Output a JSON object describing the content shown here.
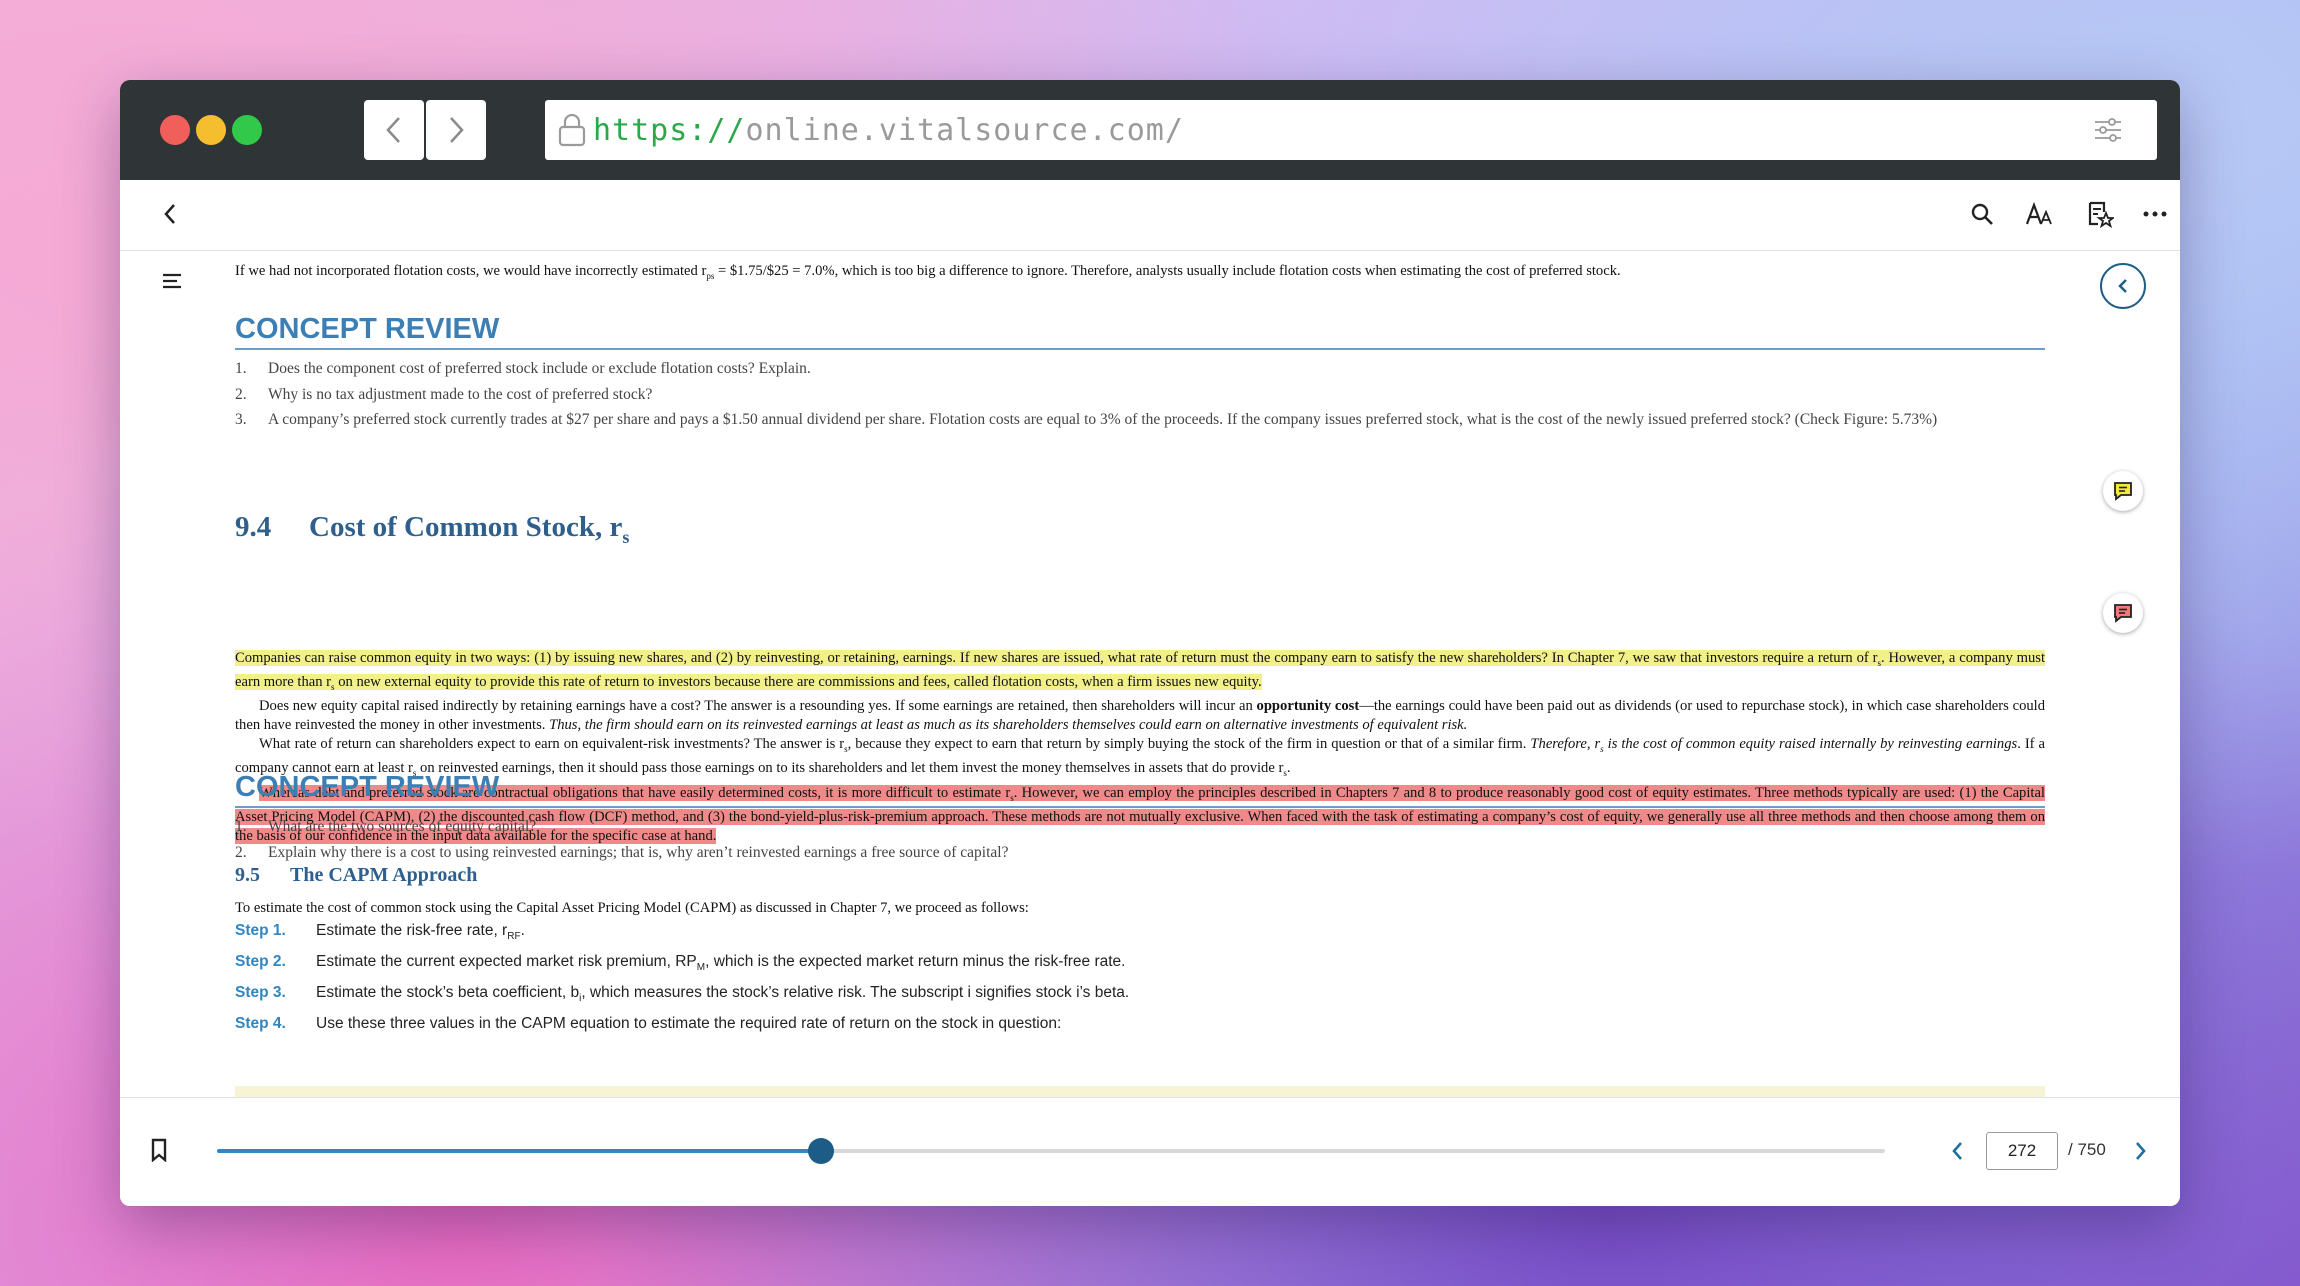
{
  "browser": {
    "url_scheme": "https://",
    "url_host": "online.vitalsource.com/",
    "colors": {
      "close": "#f15f5a",
      "minimize": "#f5be2e",
      "maximize": "#32c84a",
      "scheme": "#2ba84a",
      "host": "#9a9a9a"
    }
  },
  "reader": {
    "top_paragraph_pre": "If we had not incorporated flotation costs, we would have incorrectly estimated r",
    "top_paragraph_sub": "ps",
    "top_paragraph_post": " = $1.75/$25 = 7.0%, which is too big a difference to ignore. Therefore, analysts usually include flotation costs when estimating the cost of preferred stock.",
    "concept_review_1": {
      "title": "CONCEPT REVIEW",
      "items": [
        {
          "num": "1.",
          "text": "Does the component cost of preferred stock include or exclude flotation costs? Explain."
        },
        {
          "num": "2.",
          "text": "Why is no tax adjustment made to the cost of preferred stock?"
        },
        {
          "num": "3.",
          "text": "A company’s preferred stock currently trades at $27 per share and pays a $1.50 annual dividend per share. Flotation costs are equal to 3% of the proceeds. If the company issues preferred stock, what is the cost of the newly issued preferred stock? (Check Figure: 5.73%)"
        }
      ]
    },
    "section_94": {
      "number": "9.4",
      "title": "Cost of Common Stock, r",
      "title_sub": "s",
      "para1_a": "Companies can raise common equity in two ways: (1) by issuing new shares, and (2) by reinvesting, or retaining, earnings. If new shares are issued, what rate of return must the company earn to satisfy the new shareholders? In Chapter 7, we saw that investors require a return of r",
      "para1_sub1": "s",
      "para1_b": ". However, a company must earn more than r",
      "para1_sub2": "s",
      "para1_c": " on new external equity to provide this rate of return to investors because there are commissions and fees, called flotation costs, when a firm issues new equity.",
      "para2_a": "Does new equity capital raised indirectly by retaining earnings have a cost? The answer is a resounding yes. If some earnings are retained, then shareholders will incur an ",
      "para2_bold": "opportunity cost",
      "para2_b": "—the earnings could have been paid out as dividends (or used to repurchase stock), in which case shareholders could then have reinvested the money in other investments. ",
      "para2_italic": "Thus, the firm should earn on its reinvested earnings at least as much as its shareholders themselves could earn on alternative investments of equivalent risk.",
      "para3_a": "What rate of return can shareholders expect to earn on equivalent-risk investments? The answer is r",
      "para3_sub1": "s",
      "para3_b": ", because they expect to earn that return by simply buying the stock of the firm in question or that of a similar firm. ",
      "para3_italic_a": "Therefore, r",
      "para3_sub2": "s",
      "para3_italic_b": " is the cost of common equity raised internally by reinvesting earnings",
      "para3_c": ". If a company cannot earn at least r",
      "para3_sub3": "s",
      "para3_d": " on reinvested earnings, then it should pass those earnings on to its shareholders and let them invest the money themselves in assets that do provide r",
      "para3_sub4": "s",
      "para3_e": ".",
      "para4_a": "Whereas debt and preferred stock are contractual obligations that have easily determined costs, it is more difficult to estimate r",
      "para4_sub": "s",
      "para4_b": ". However, we can employ the principles described in Chapters 7 and 8 to produce reasonably good cost of equity estimates. Three methods typically are used: (1) the Capital Asset Pricing Model (CAPM), (2) the discounted cash flow (DCF) method, and (3) the bond-yield-plus-risk-premium approach. These methods are not mutually exclusive. When faced with the task of estimating a company’s cost of equity, we generally use all three methods and then choose among them on the basis of our confidence in the input data available for the specific case at hand."
    },
    "concept_review_2": {
      "title": "CONCEPT REVIEW",
      "items": [
        {
          "num": "1.",
          "text": "What are the two sources of equity capital?"
        },
        {
          "num": "2.",
          "text": "Explain why there is a cost to using reinvested earnings; that is, why aren’t reinvested earnings a free source of capital?"
        }
      ]
    },
    "section_95": {
      "number": "9.5",
      "title": "The CAPM Approach",
      "intro": "To estimate the cost of common stock using the Capital Asset Pricing Model (CAPM) as discussed in Chapter 7, we proceed as follows:",
      "steps": [
        {
          "label": "Step 1.",
          "text_a": "Estimate the risk-free rate, r",
          "sub": "RF",
          "text_b": "."
        },
        {
          "label": "Step 2.",
          "text_a": "Estimate the current expected market risk premium, RP",
          "sub": "M",
          "text_b": ", which is the expected market return minus the risk-free rate."
        },
        {
          "label": "Step 3.",
          "text_a": "Estimate the stock’s beta coefficient, b",
          "sub": "i",
          "text_b": ", which measures the stock’s relative risk. The subscript i signifies stock i’s beta."
        },
        {
          "label": "Step 4.",
          "text_a": "Use these three values in the CAPM equation to estimate the required rate of return on the stock in question:",
          "sub": "",
          "text_b": ""
        }
      ]
    }
  },
  "pager": {
    "current_page": "272",
    "total_label": "/ 750",
    "progress": 0.362
  },
  "icons": {
    "back": "chevron-left-icon",
    "search": "search-icon",
    "font": "font-size-icon",
    "bookmarks": "bookmark-list-icon",
    "more": "more-icon",
    "toc": "table-of-contents-icon",
    "collapse": "collapse-panel-icon",
    "note": "note-icon",
    "bookmark": "bookmark-icon"
  },
  "colors": {
    "accent": "#1a6fa0",
    "highlight_yellow": "#f2f08a",
    "highlight_red": "#f08a8a",
    "heading_blue": "#3b7fb4"
  }
}
